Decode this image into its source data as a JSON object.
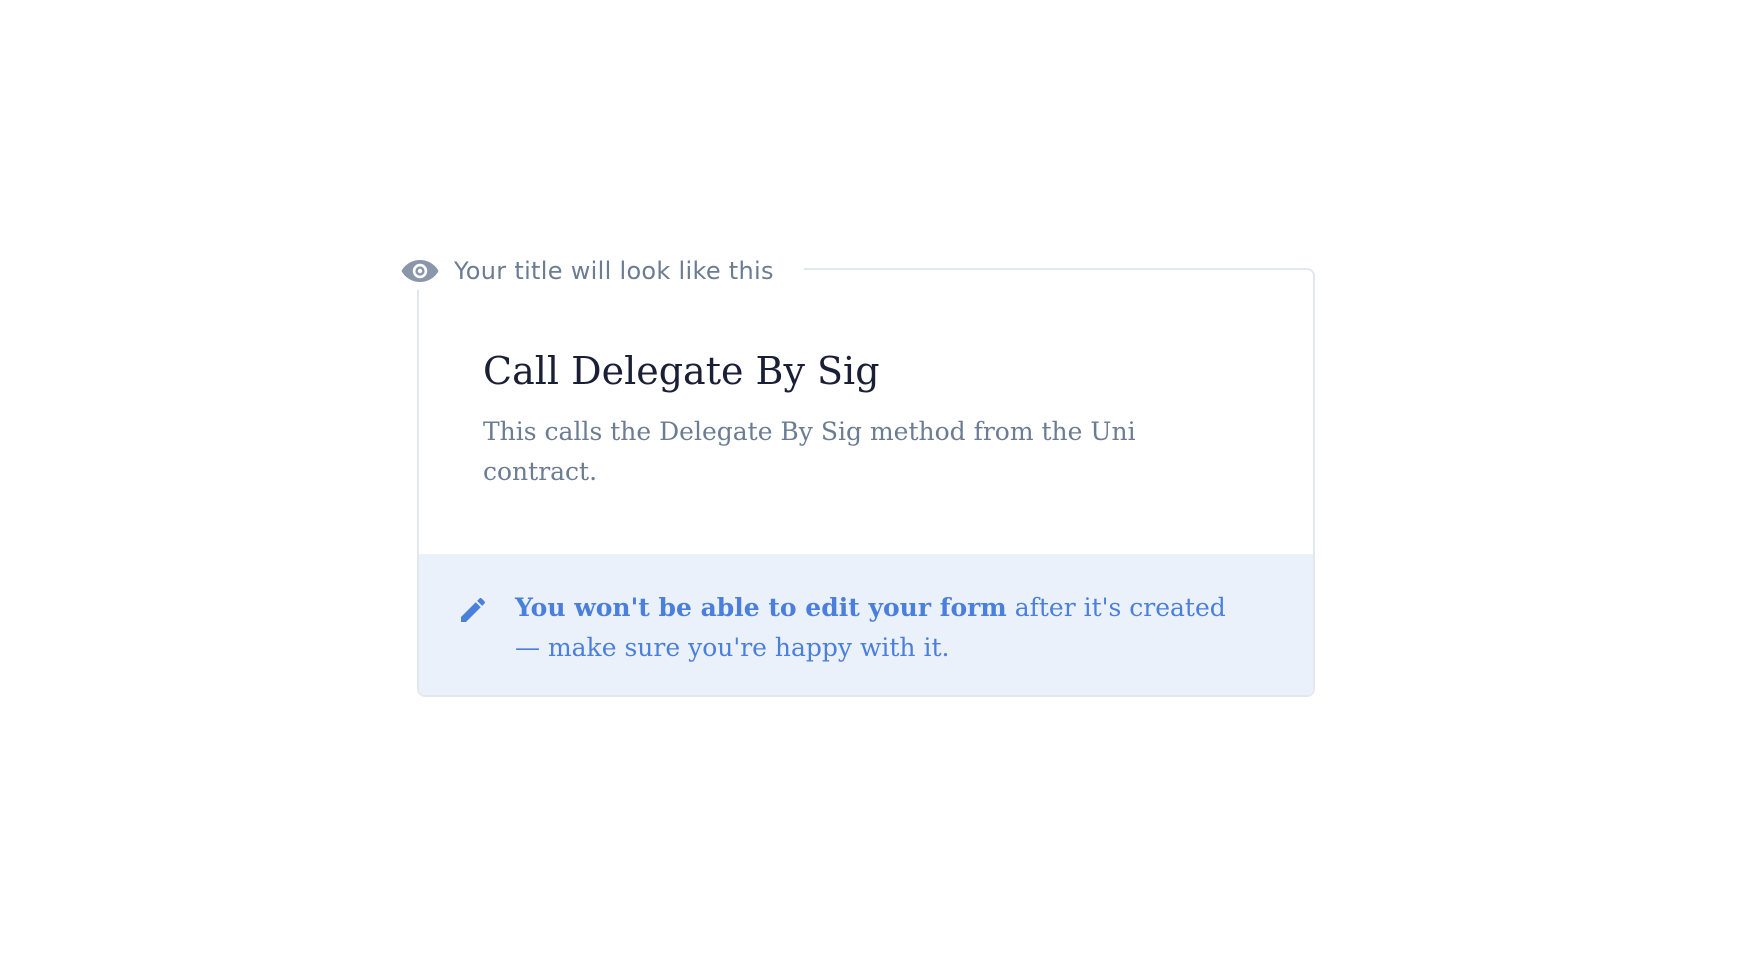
{
  "preview": {
    "label": "Your title will look like this",
    "icon": "eye-icon"
  },
  "form": {
    "title": "Call Delegate By Sig",
    "description": "This calls the Delegate By Sig method from the Uni contract."
  },
  "notice": {
    "icon": "pencil-icon",
    "strong_text": "You won't be able to edit your form",
    "text": " after it's created — make sure you're happy with it."
  },
  "colors": {
    "label_gray": "#6b7c93",
    "title_dark": "#1a1f36",
    "notice_blue": "#4b7fdc",
    "notice_bg": "#ebf1fb",
    "card_border": "#e3e8ef"
  }
}
